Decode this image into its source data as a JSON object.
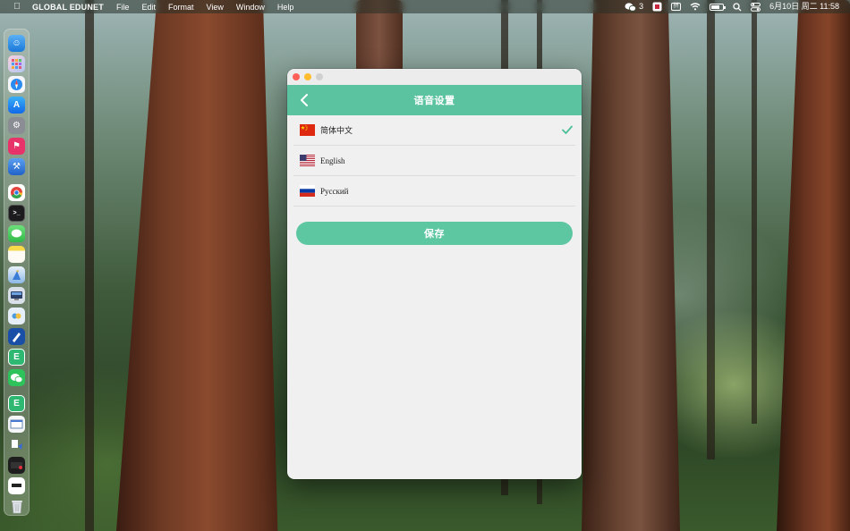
{
  "menubar": {
    "apple_icon": "apple-icon",
    "app_name": "GLOBAL EDUNET",
    "items": [
      "File",
      "Edit",
      "Format",
      "View",
      "Window",
      "Help"
    ],
    "wechat_badge": "3",
    "date_time": "6月10日 周二  11:58"
  },
  "dock": {
    "icons": [
      "finder-icon",
      "launchpad-icon",
      "safari-icon",
      "app-store-icon",
      "system-settings-icon",
      "flag-app-icon",
      "xcode-icon",
      "chrome-icon",
      "terminal-icon",
      "messages-icon",
      "notes-icon",
      "preview-icon",
      "monitor-app-icon",
      "hands-app-icon",
      "pen-app-icon",
      "edunet-app-icon",
      "wechat-icon",
      "edunet-app-icon-2",
      "window-app-icon",
      "file-app-icon",
      "screen-app-icon",
      "white-app-icon",
      "trash-icon"
    ]
  },
  "window": {
    "title": "语音设置",
    "back_icon": "chevron-left-icon",
    "languages": [
      {
        "label": "简体中文",
        "flag": "china-flag-icon",
        "selected": true
      },
      {
        "label": "English",
        "flag": "usa-flag-icon",
        "selected": false
      },
      {
        "label": "Русский",
        "flag": "russia-flag-icon",
        "selected": false
      }
    ],
    "save_label": "保存",
    "accent_color": "#5cc3a0"
  }
}
